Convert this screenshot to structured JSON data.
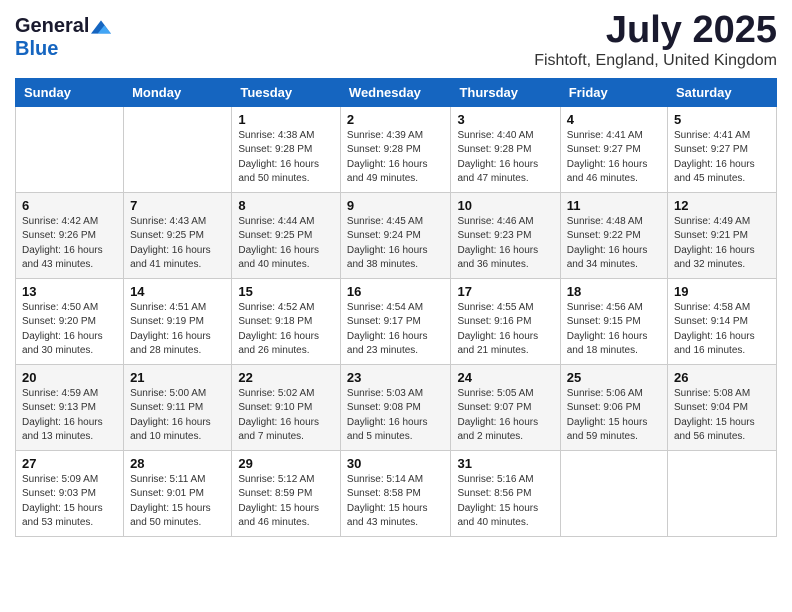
{
  "logo": {
    "general": "General",
    "blue": "Blue"
  },
  "title": {
    "month": "July 2025",
    "location": "Fishtoft, England, United Kingdom"
  },
  "weekdays": [
    "Sunday",
    "Monday",
    "Tuesday",
    "Wednesday",
    "Thursday",
    "Friday",
    "Saturday"
  ],
  "weeks": [
    [
      {
        "day": "",
        "info": ""
      },
      {
        "day": "",
        "info": ""
      },
      {
        "day": "1",
        "info": "Sunrise: 4:38 AM\nSunset: 9:28 PM\nDaylight: 16 hours and 50 minutes."
      },
      {
        "day": "2",
        "info": "Sunrise: 4:39 AM\nSunset: 9:28 PM\nDaylight: 16 hours and 49 minutes."
      },
      {
        "day": "3",
        "info": "Sunrise: 4:40 AM\nSunset: 9:28 PM\nDaylight: 16 hours and 47 minutes."
      },
      {
        "day": "4",
        "info": "Sunrise: 4:41 AM\nSunset: 9:27 PM\nDaylight: 16 hours and 46 minutes."
      },
      {
        "day": "5",
        "info": "Sunrise: 4:41 AM\nSunset: 9:27 PM\nDaylight: 16 hours and 45 minutes."
      }
    ],
    [
      {
        "day": "6",
        "info": "Sunrise: 4:42 AM\nSunset: 9:26 PM\nDaylight: 16 hours and 43 minutes."
      },
      {
        "day": "7",
        "info": "Sunrise: 4:43 AM\nSunset: 9:25 PM\nDaylight: 16 hours and 41 minutes."
      },
      {
        "day": "8",
        "info": "Sunrise: 4:44 AM\nSunset: 9:25 PM\nDaylight: 16 hours and 40 minutes."
      },
      {
        "day": "9",
        "info": "Sunrise: 4:45 AM\nSunset: 9:24 PM\nDaylight: 16 hours and 38 minutes."
      },
      {
        "day": "10",
        "info": "Sunrise: 4:46 AM\nSunset: 9:23 PM\nDaylight: 16 hours and 36 minutes."
      },
      {
        "day": "11",
        "info": "Sunrise: 4:48 AM\nSunset: 9:22 PM\nDaylight: 16 hours and 34 minutes."
      },
      {
        "day": "12",
        "info": "Sunrise: 4:49 AM\nSunset: 9:21 PM\nDaylight: 16 hours and 32 minutes."
      }
    ],
    [
      {
        "day": "13",
        "info": "Sunrise: 4:50 AM\nSunset: 9:20 PM\nDaylight: 16 hours and 30 minutes."
      },
      {
        "day": "14",
        "info": "Sunrise: 4:51 AM\nSunset: 9:19 PM\nDaylight: 16 hours and 28 minutes."
      },
      {
        "day": "15",
        "info": "Sunrise: 4:52 AM\nSunset: 9:18 PM\nDaylight: 16 hours and 26 minutes."
      },
      {
        "day": "16",
        "info": "Sunrise: 4:54 AM\nSunset: 9:17 PM\nDaylight: 16 hours and 23 minutes."
      },
      {
        "day": "17",
        "info": "Sunrise: 4:55 AM\nSunset: 9:16 PM\nDaylight: 16 hours and 21 minutes."
      },
      {
        "day": "18",
        "info": "Sunrise: 4:56 AM\nSunset: 9:15 PM\nDaylight: 16 hours and 18 minutes."
      },
      {
        "day": "19",
        "info": "Sunrise: 4:58 AM\nSunset: 9:14 PM\nDaylight: 16 hours and 16 minutes."
      }
    ],
    [
      {
        "day": "20",
        "info": "Sunrise: 4:59 AM\nSunset: 9:13 PM\nDaylight: 16 hours and 13 minutes."
      },
      {
        "day": "21",
        "info": "Sunrise: 5:00 AM\nSunset: 9:11 PM\nDaylight: 16 hours and 10 minutes."
      },
      {
        "day": "22",
        "info": "Sunrise: 5:02 AM\nSunset: 9:10 PM\nDaylight: 16 hours and 7 minutes."
      },
      {
        "day": "23",
        "info": "Sunrise: 5:03 AM\nSunset: 9:08 PM\nDaylight: 16 hours and 5 minutes."
      },
      {
        "day": "24",
        "info": "Sunrise: 5:05 AM\nSunset: 9:07 PM\nDaylight: 16 hours and 2 minutes."
      },
      {
        "day": "25",
        "info": "Sunrise: 5:06 AM\nSunset: 9:06 PM\nDaylight: 15 hours and 59 minutes."
      },
      {
        "day": "26",
        "info": "Sunrise: 5:08 AM\nSunset: 9:04 PM\nDaylight: 15 hours and 56 minutes."
      }
    ],
    [
      {
        "day": "27",
        "info": "Sunrise: 5:09 AM\nSunset: 9:03 PM\nDaylight: 15 hours and 53 minutes."
      },
      {
        "day": "28",
        "info": "Sunrise: 5:11 AM\nSunset: 9:01 PM\nDaylight: 15 hours and 50 minutes."
      },
      {
        "day": "29",
        "info": "Sunrise: 5:12 AM\nSunset: 8:59 PM\nDaylight: 15 hours and 46 minutes."
      },
      {
        "day": "30",
        "info": "Sunrise: 5:14 AM\nSunset: 8:58 PM\nDaylight: 15 hours and 43 minutes."
      },
      {
        "day": "31",
        "info": "Sunrise: 5:16 AM\nSunset: 8:56 PM\nDaylight: 15 hours and 40 minutes."
      },
      {
        "day": "",
        "info": ""
      },
      {
        "day": "",
        "info": ""
      }
    ]
  ]
}
